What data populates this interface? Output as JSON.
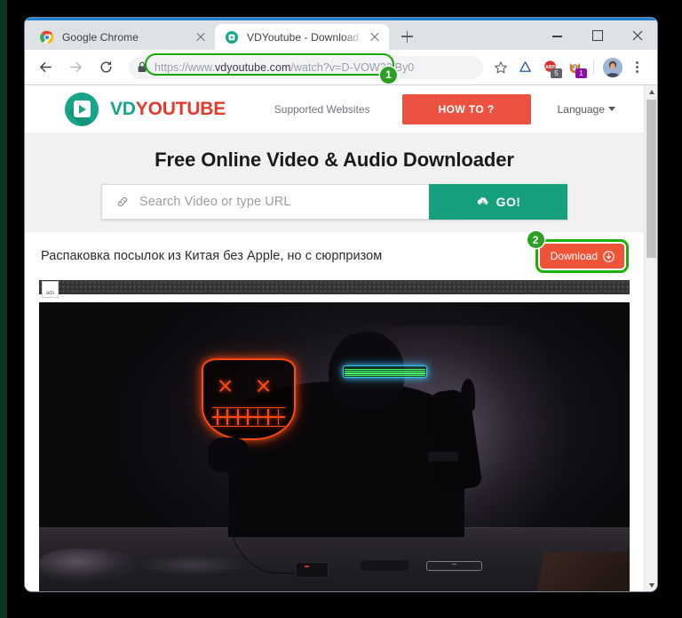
{
  "browser": {
    "tabs": [
      {
        "title": "Google Chrome",
        "favicon": "chrome-logo-icon",
        "active": false
      },
      {
        "title": "VDYoutube - Download Video:\" P",
        "favicon": "vdyoutube-icon",
        "active": true
      }
    ],
    "new_tab_label": "+",
    "window_controls": {
      "minimize": "–",
      "maximize": "□",
      "close": "✕"
    },
    "nav": {
      "back": "←",
      "forward": "→",
      "reload": "⟳"
    },
    "omnibox": {
      "lock_icon": "lock-icon",
      "url_scheme": "https://www.",
      "url_domain": "vdyoutube.com",
      "url_path": "/watch?v=D-VOW32iBy0",
      "url_full": "https://www.vdyoutube.com/watch?v=D-VOW32iBy0"
    },
    "toolbar_icons": [
      {
        "name": "bookmark-star-icon",
        "glyph": "☆",
        "badge": ""
      },
      {
        "name": "extension-triangle-icon",
        "glyph": "△",
        "badge": ""
      },
      {
        "name": "adblock-icon",
        "glyph": "ABP",
        "badge": "5"
      },
      {
        "name": "extension-fox-icon",
        "glyph": "",
        "badge": "1"
      },
      {
        "name": "profile-avatar",
        "glyph": "",
        "badge": ""
      },
      {
        "name": "chrome-menu-icon",
        "glyph": "⋮",
        "badge": ""
      }
    ]
  },
  "annotations": {
    "step_one": "1",
    "step_two": "2",
    "highlight_color": "#14a800"
  },
  "site": {
    "logo": {
      "prefix": "VD",
      "suffix": "YOUTUBE"
    },
    "nav": {
      "supported_websites": "Supported Websites",
      "how_to": "HOW TO ?",
      "language": "Language"
    },
    "heading": "Free Online Video & Audio Downloader",
    "search": {
      "placeholder": "Search Video or type URL",
      "value": "",
      "icon": "link-icon",
      "go_label": "GO!",
      "go_icon": "cloud-download-icon"
    },
    "result": {
      "video_title": "Распаковка посылок из Китая без Apple, но с сюрпризом",
      "download_label": "Download",
      "download_icon": "↓",
      "ads_label": "ads"
    }
  },
  "colors": {
    "brand_teal": "#17a589",
    "brand_red": "#e23b2e",
    "howto_red": "#ec5242",
    "go_green": "#17a07d",
    "download_red": "#ef5438",
    "highlight_green": "#14a800",
    "badge_green": "#2d9f23"
  }
}
